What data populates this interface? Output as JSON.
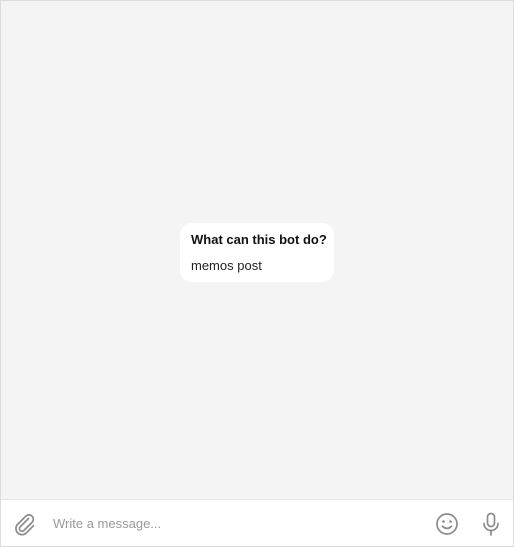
{
  "bot_intro": {
    "title": "What can this bot do?",
    "description": "memos post"
  },
  "composer": {
    "placeholder": "Write a message...",
    "attach_icon": "paperclip-icon",
    "emoji_icon": "smiley-icon",
    "mic_icon": "microphone-icon"
  },
  "colors": {
    "chat_background": "#f4f4f4",
    "card_background": "#ffffff",
    "icon_color": "#8a8a8a",
    "placeholder_color": "#999999"
  }
}
